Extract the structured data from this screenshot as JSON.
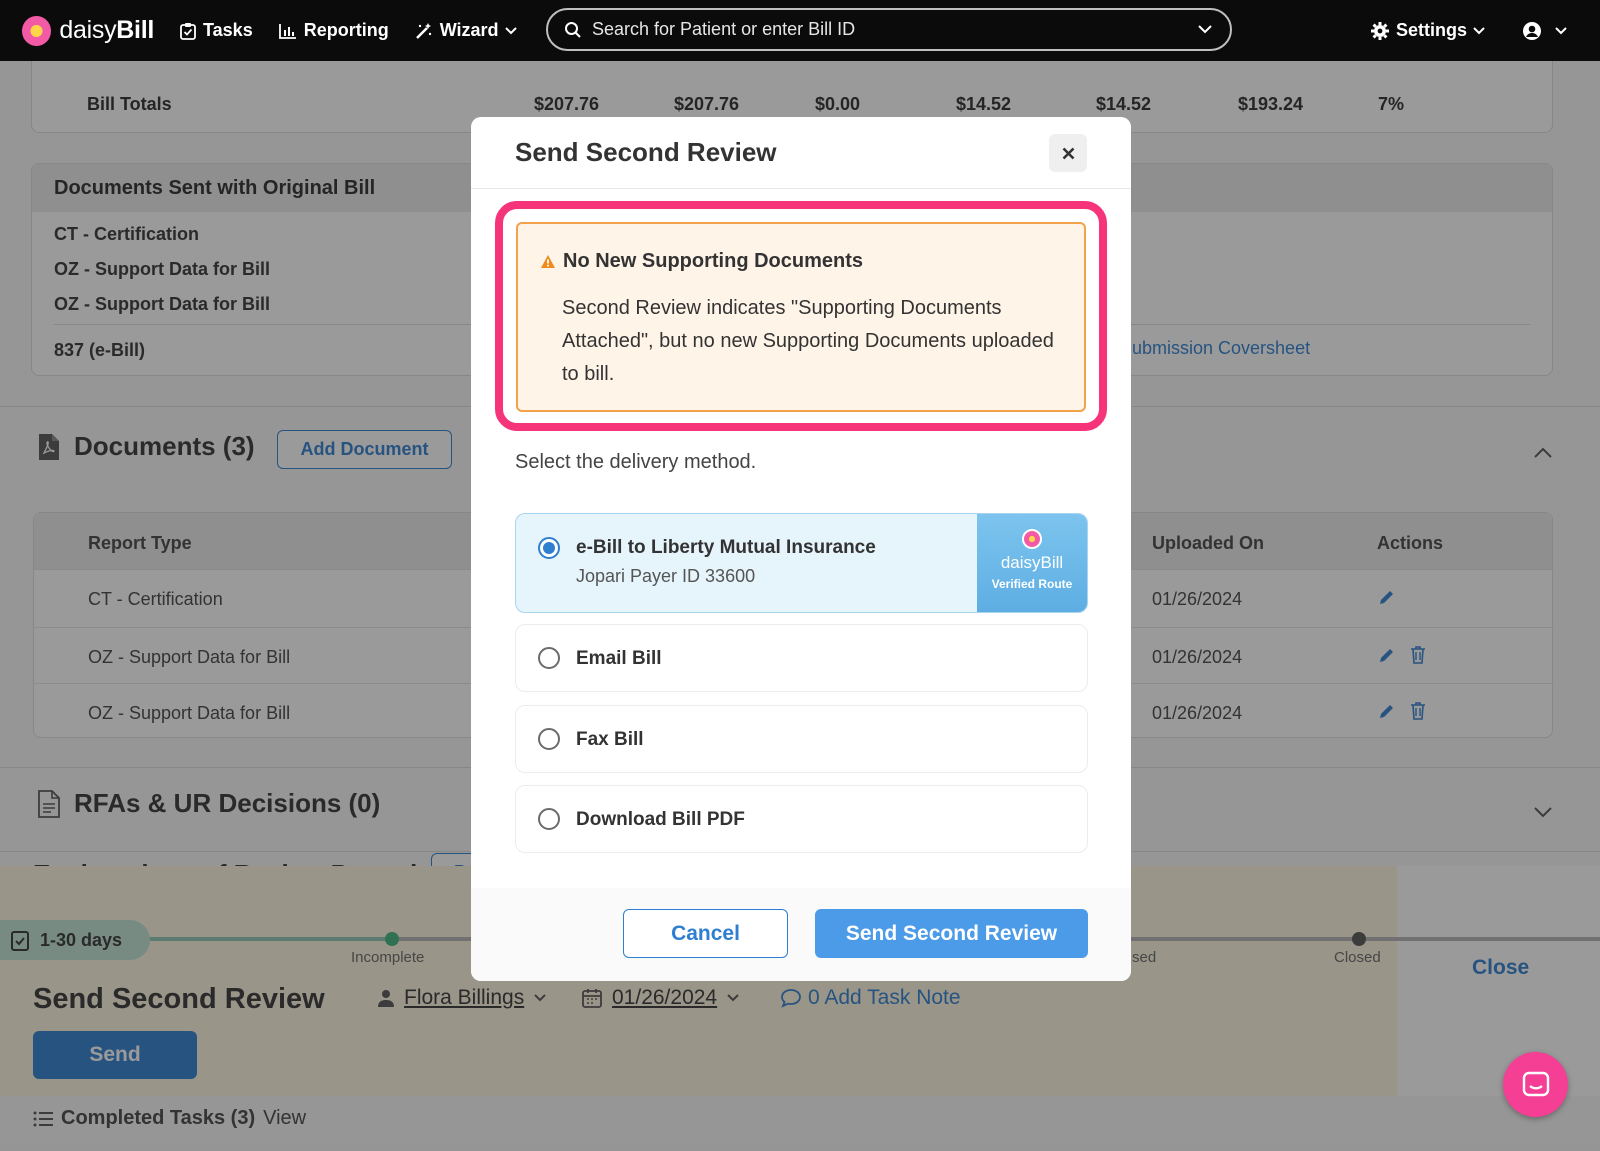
{
  "nav": {
    "logo_light": "daisy",
    "logo_bold": "Bill",
    "tasks": "Tasks",
    "reporting": "Reporting",
    "wizard": "Wizard",
    "search_placeholder": "Search for Patient or enter Bill ID",
    "settings": "Settings"
  },
  "bill_totals": {
    "label": "Bill Totals",
    "values": [
      "$207.76",
      "$207.76",
      "$0.00",
      "$14.52",
      "$14.52",
      "$193.24",
      "7%"
    ]
  },
  "docs_original": {
    "title": "Documents Sent with Original Bill",
    "rows": [
      "CT - Certification",
      "OZ - Support Data for Bill",
      "OZ - Support Data for Bill",
      "837 (e-Bill)"
    ],
    "link": "ubmission Coversheet"
  },
  "documents": {
    "title": "Documents (3)",
    "add_button": "Add Document",
    "columns": {
      "report_type": "Report Type",
      "uploaded_on": "Uploaded On",
      "actions": "Actions"
    },
    "rows": [
      {
        "type": "CT - Certification",
        "date": "01/26/2024"
      },
      {
        "type": "OZ - Support Data for Bill",
        "date": "01/26/2024"
      },
      {
        "type": "OZ - Support Data for Bill",
        "date": "01/26/2024"
      }
    ]
  },
  "rfas": {
    "title": "RFAs & UR Decisions (0)"
  },
  "eor": {
    "title": "Explanations of Review Posted",
    "button": "Po"
  },
  "task": {
    "days": "1-30 days",
    "stage_incomplete": "Incomplete",
    "stage_partial": "sed",
    "stage_closed": "Closed",
    "close": "Close",
    "title": "Send Second Review",
    "assignee": "Flora Billings",
    "date": "01/26/2024",
    "note": "0 Add Task Note",
    "send": "Send",
    "completed_label": "Completed Tasks (3)",
    "completed_view": "View"
  },
  "modal": {
    "title": "Send Second Review",
    "warning_title": "No New Supporting Documents",
    "warning_body": "Second Review indicates \"Supporting Documents Attached\", but no new Supporting Documents uploaded to bill.",
    "subtitle": "Select the delivery method.",
    "options": [
      {
        "label": "e-Bill to Liberty Mutual Insurance",
        "sub": "Jopari Payer ID 33600",
        "selected": true
      },
      {
        "label": "Email Bill"
      },
      {
        "label": "Fax Bill"
      },
      {
        "label": "Download Bill PDF"
      }
    ],
    "badge_brand_light": "daisy",
    "badge_brand_bold": "Bill",
    "badge_text": "Verified Route",
    "cancel": "Cancel",
    "confirm": "Send Second Review"
  },
  "colors": {
    "accent": "#2f7fd1",
    "highlight": "#f5347a",
    "warning_border": "#f2a24a"
  }
}
